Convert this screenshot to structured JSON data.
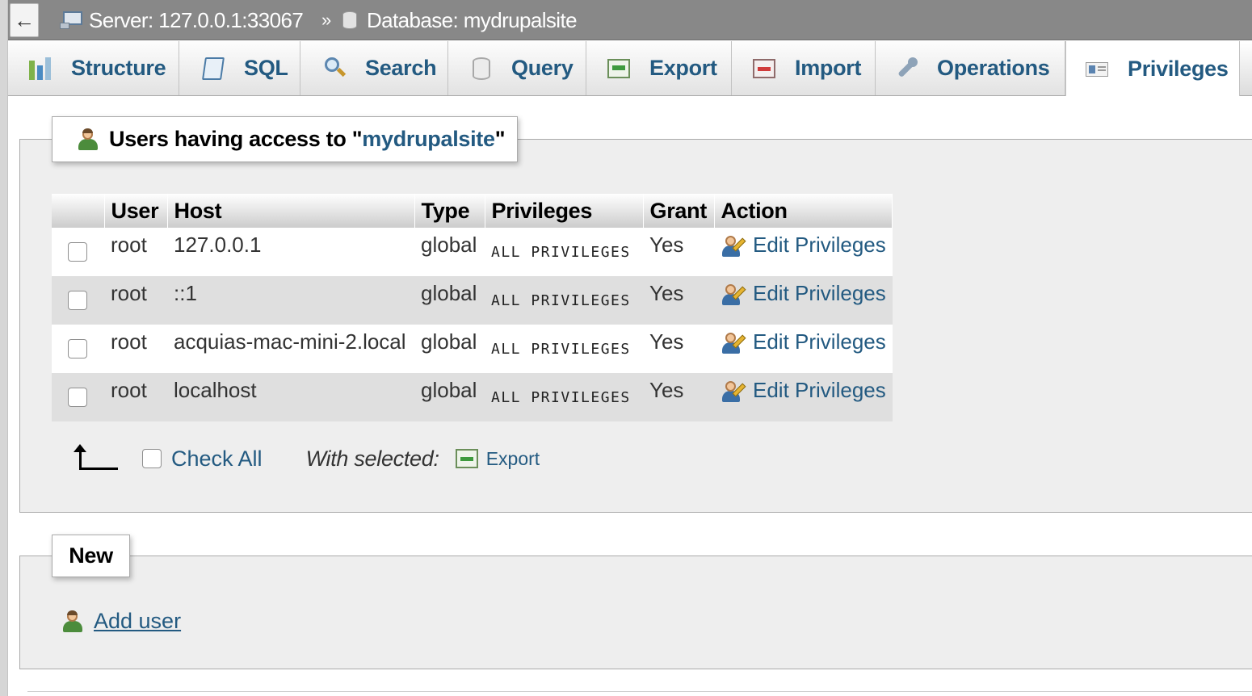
{
  "breadcrumb": {
    "back_glyph": "←",
    "server": "Server: 127.0.0.1:33067",
    "separator": "»",
    "database": "Database: mydrupalsite"
  },
  "tabs": [
    {
      "label": "Structure",
      "icon": "structure-icon"
    },
    {
      "label": "SQL",
      "icon": "sql-icon"
    },
    {
      "label": "Search",
      "icon": "search-icon"
    },
    {
      "label": "Query",
      "icon": "query-icon"
    },
    {
      "label": "Export",
      "icon": "export-icon"
    },
    {
      "label": "Import",
      "icon": "import-icon"
    },
    {
      "label": "Operations",
      "icon": "wrench-icon"
    },
    {
      "label": "Privileges",
      "icon": "privileges-icon",
      "active": true
    }
  ],
  "users_section": {
    "title_prefix": "Users having access to \"",
    "title_db": "mydrupalsite",
    "title_suffix": "\""
  },
  "table": {
    "headers": [
      "User",
      "Host",
      "Type",
      "Privileges",
      "Grant",
      "Action"
    ],
    "rows": [
      {
        "user": "root",
        "host": "127.0.0.1",
        "type": "global",
        "privileges": "ALL PRIVILEGES",
        "grant": "Yes",
        "action": "Edit Privileges"
      },
      {
        "user": "root",
        "host": "::1",
        "type": "global",
        "privileges": "ALL PRIVILEGES",
        "grant": "Yes",
        "action": "Edit Privileges"
      },
      {
        "user": "root",
        "host": "acquias-mac-mini-2.local",
        "type": "global",
        "privileges": "ALL PRIVILEGES",
        "grant": "Yes",
        "action": "Edit Privileges"
      },
      {
        "user": "root",
        "host": "localhost",
        "type": "global",
        "privileges": "ALL PRIVILEGES",
        "grant": "Yes",
        "action": "Edit Privileges"
      }
    ]
  },
  "footer": {
    "check_all": "Check All",
    "with_selected": "With selected:",
    "export": "Export"
  },
  "new_section": {
    "title": "New",
    "add_user": "Add user"
  },
  "colors": {
    "link": "#235a81",
    "topbar": "#888888",
    "panel": "#eeeeee",
    "row_alt": "#dfdfdf"
  }
}
